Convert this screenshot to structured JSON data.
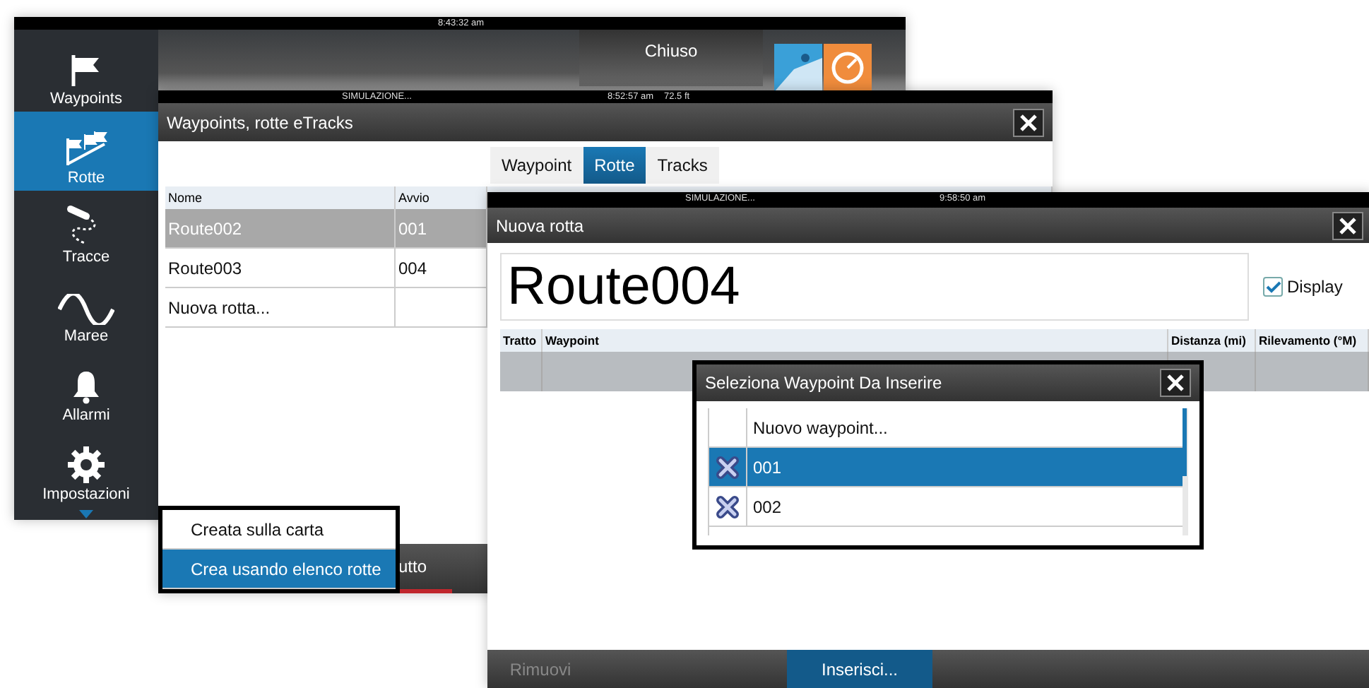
{
  "back_screen": {
    "clock": "8:43:32 am",
    "sidebar": [
      {
        "kind": "flag",
        "label": "Waypoints",
        "selected": false
      },
      {
        "kind": "route",
        "label": "Rotte",
        "selected": true
      },
      {
        "kind": "track",
        "label": "Tracce",
        "selected": false
      },
      {
        "kind": "tide",
        "label": "Maree",
        "selected": false
      },
      {
        "kind": "bell",
        "label": "Allarmi",
        "selected": false
      },
      {
        "kind": "gear",
        "label": "Impostazioni",
        "selected": false
      }
    ],
    "close_button": "Chiuso"
  },
  "routes_window": {
    "status": {
      "mode": "SIMULAZIONE...",
      "time": "8:52:57 am",
      "depth": "72.5 ft"
    },
    "title": "Waypoints, rotte eTracks",
    "tabs": [
      {
        "label": "Waypoint",
        "selected": false
      },
      {
        "label": "Rotte",
        "selected": true
      },
      {
        "label": "Tracks",
        "selected": false
      }
    ],
    "columns": [
      "Nome",
      "Avvio"
    ],
    "rows": [
      {
        "cells": [
          "Route002",
          "001"
        ],
        "selected": true
      },
      {
        "cells": [
          "Route003",
          "004"
        ],
        "selected": false
      },
      {
        "cells": [
          "Nuova rotta...",
          ""
        ],
        "selected": false
      }
    ],
    "bottom_button": "utto"
  },
  "context_menu": [
    {
      "label": "Creata sulla carta",
      "selected": false
    },
    {
      "label": "Crea usando elenco rotte",
      "selected": true
    }
  ],
  "new_route_window": {
    "status": {
      "mode": "SIMULAZIONE...",
      "time": "9:58:50 am"
    },
    "title": "Nuova rotta",
    "name": "Route004",
    "display": {
      "label": "Display",
      "checked": true
    },
    "columns": [
      "Tratto",
      "Waypoint",
      "Distanza (mi)",
      "Rilevamento (°M)"
    ],
    "buttons": [
      {
        "label": "Rimuovi",
        "disabled": true,
        "selected": false
      },
      {
        "label": "Inserisci...",
        "disabled": false,
        "selected": true
      }
    ]
  },
  "waypoint_dialog": {
    "title": "Seleziona Waypoint Da Inserire",
    "rows": [
      {
        "label": "Nuovo waypoint...",
        "kind": "new",
        "selected": false
      },
      {
        "label": "001",
        "kind": "waypoint",
        "selected": true
      },
      {
        "label": "002",
        "kind": "waypoint",
        "selected": false
      }
    ]
  }
}
